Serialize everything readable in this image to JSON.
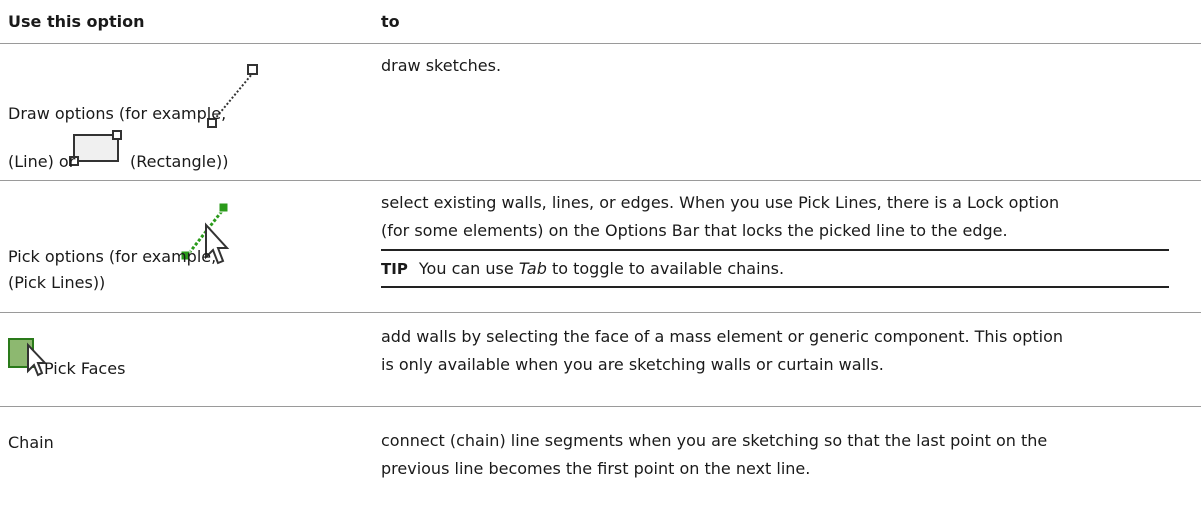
{
  "header": {
    "col1": "Use this option",
    "col2": "to"
  },
  "rows": [
    {
      "option_prefix": "Draw options (for example,",
      "option_line_label": "(Line) or",
      "option_suffix": "(Rectangle))",
      "description": "draw sketches."
    },
    {
      "option_prefix": "Pick options (for example,",
      "option_suffix": "(Pick Lines))",
      "description_line1": "select existing walls, lines, or edges. When you use Pick Lines, there is a Lock option",
      "description_line2": "(for some elements) on the Options Bar that locks the picked line to the edge.",
      "tip_label": "TIP",
      "tip_before": "You can use",
      "tip_key": "Tab",
      "tip_after": "to toggle to available chains."
    },
    {
      "option_label": "Pick Faces",
      "description_line1": "add walls by selecting the face of a mass element or generic component. This option",
      "description_line2": "is only available when you are sketching walls or curtain walls."
    },
    {
      "option_label": "Chain",
      "description_line1": "connect (chain) line segments when you are sketching so that the last point on the",
      "description_line2": "previous line becomes the first point on the next line."
    }
  ],
  "icons": {
    "line": "line-tool-icon",
    "rectangle": "rectangle-tool-icon",
    "pick_lines": "pick-lines-icon",
    "pick_faces": "pick-faces-icon",
    "pick_line_color": "#2a9a1a",
    "face_fill": "#8db870"
  }
}
